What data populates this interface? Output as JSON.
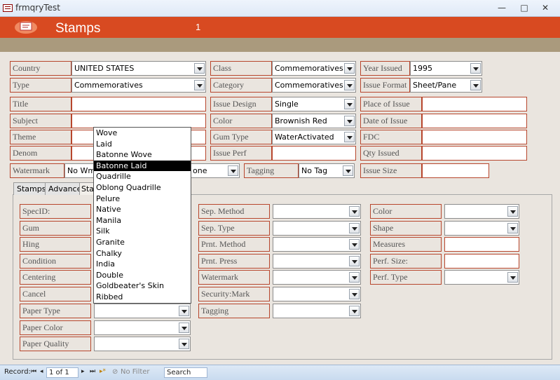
{
  "window": {
    "title": "frmqryTest",
    "minimize": "—",
    "maximize": "□",
    "close": "✕"
  },
  "header": {
    "title": "Stamps",
    "record_indicator": "1"
  },
  "top_fields": {
    "country": {
      "label": "Country",
      "value": "UNITED STATES"
    },
    "class": {
      "label": "Class",
      "value": "Commemoratives"
    },
    "year_issued": {
      "label": "Year Issued",
      "value": "1995"
    },
    "type": {
      "label": "Type",
      "value": "Commemoratives"
    },
    "category": {
      "label": "Category",
      "value": "Commemoratives"
    },
    "issue_format": {
      "label": "Issue Format",
      "value": "Sheet/Pane"
    },
    "title": {
      "label": "Title",
      "value": ""
    },
    "issue_design": {
      "label": "Issue Design",
      "value": "Single"
    },
    "place_of_issue": {
      "label": "Place of Issue",
      "value": ""
    },
    "subject": {
      "label": "Subject",
      "value": ""
    },
    "color": {
      "label": "Color",
      "value": "Brownish Red"
    },
    "date_of_issue": {
      "label": "Date of Issue",
      "value": ""
    },
    "theme": {
      "label": "Theme",
      "value": ""
    },
    "gum_type": {
      "label": "Gum Type",
      "value": "WaterActivated"
    },
    "fdc": {
      "label": "FDC",
      "value": ""
    },
    "denom": {
      "label": "Denom",
      "value": ""
    },
    "issue_perf": {
      "label": "Issue Perf",
      "value": ""
    },
    "qty_issued": {
      "label": "Qty Issued",
      "value": ""
    },
    "watermark": {
      "label": "Watermark",
      "value": "No Wm",
      "value2": "one"
    },
    "tagging": {
      "label": "Tagging",
      "value": "No Tag"
    },
    "issue_size": {
      "label": "Issue Size",
      "value": ""
    }
  },
  "tabs": [
    "Stamps",
    "Advance",
    "Sta"
  ],
  "sub_fields": {
    "spec_id": "SpecID:",
    "gum": "Gum",
    "hing": "Hing",
    "condition": "Condition",
    "centering": "Centering",
    "cancel": "Cancel",
    "paper_type": "Paper Type",
    "paper_color": "Paper Color",
    "paper_quality": "Paper Quality",
    "sep_method": "Sep. Method",
    "sep_type": "Sep. Type",
    "prnt_method": "Prnt. Method",
    "prnt_press": "Prnt. Press",
    "watermark": "Watermark",
    "security_mark": "Security:Mark",
    "tagging": "Tagging",
    "color": "Color",
    "shape": "Shape",
    "measures": "Measures",
    "perf_size": "Perf. Size:",
    "perf_type": "Perf. Type"
  },
  "paper_dropdown": {
    "options": [
      "Wove",
      "Laid",
      "Batonne Wove",
      "Batonne Laid",
      "Quadrille",
      "Oblong Quadrille",
      "Pelure",
      "Native",
      "Manila",
      "Silk",
      "Granite",
      "Chalky",
      "India",
      "Double",
      "Goldbeater's Skin",
      "Ribbed"
    ],
    "selected": "Batonne Laid"
  },
  "statusbar": {
    "record_label": "Record:",
    "position": "1 of 1",
    "filter": "No Filter",
    "search": "Search"
  },
  "colors": {
    "banner": "#d84a21",
    "band": "#aa9a7d",
    "form": "#eae5df",
    "label_border": "#b7462d"
  }
}
